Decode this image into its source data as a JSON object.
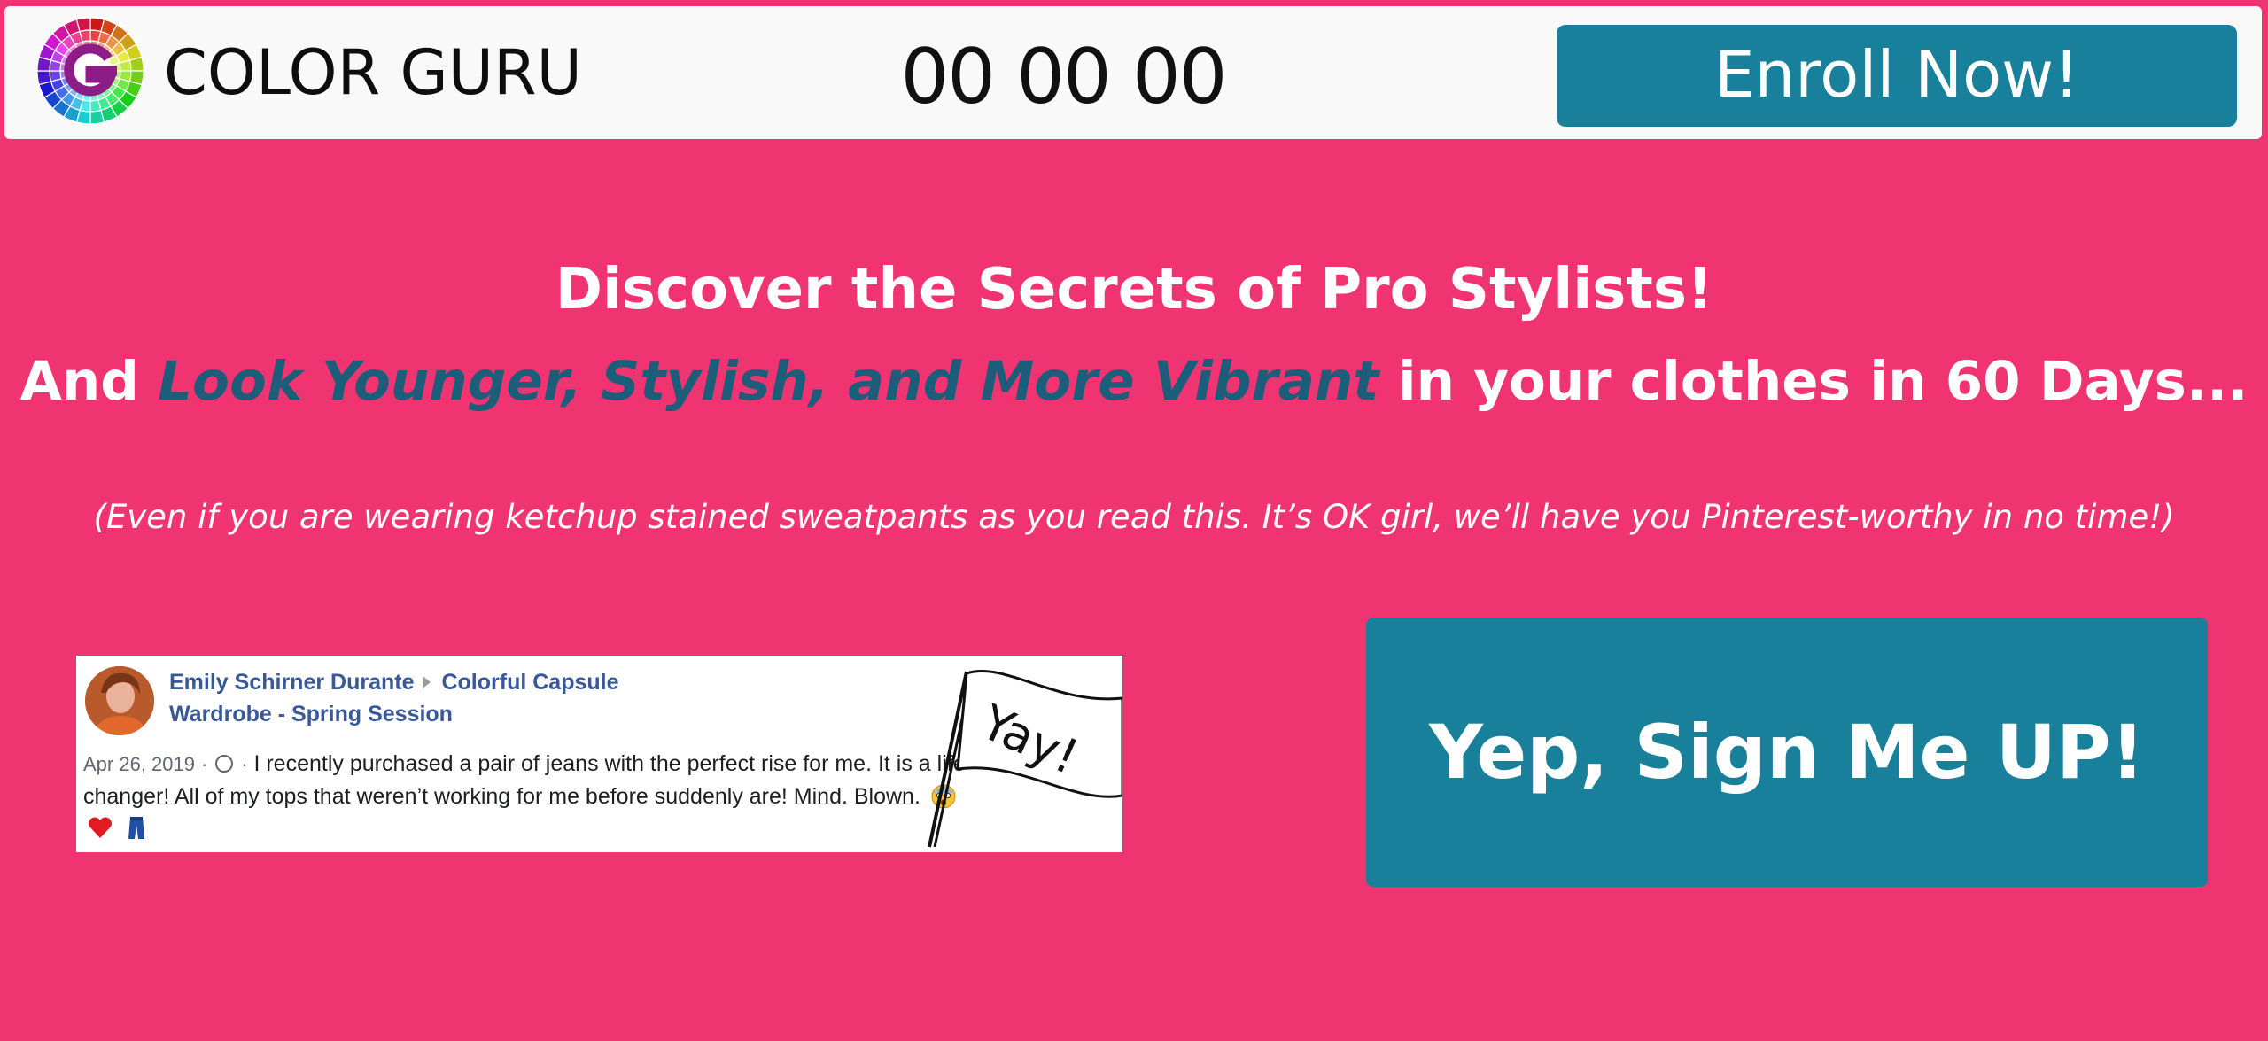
{
  "header": {
    "brand": "COLOR GURU",
    "countdown": "00 00 00",
    "enroll_label": "Enroll Now!"
  },
  "hero": {
    "headline": "Discover the Secrets of Pro Stylists!",
    "sub_prefix": "And ",
    "sub_accent": "Look Younger, Stylish, and More Vibrant",
    "sub_suffix": " in your clothes in 60 Days...",
    "note": "(Even if you are wearing ketchup stained sweatpants as you read this.  It’s OK girl, we’ll have you Pinterest-worthy in no time!)"
  },
  "testimonial": {
    "author": "Emily Schirner Durante",
    "group": "Colorful Capsule Wardrobe - Spring Session",
    "date": "Apr 26, 2019",
    "separator": "·",
    "text": "I recently purchased a pair of jeans with the perfect rise for me. It is a life changer! All of my tops that weren’t working for me before suddenly are! Mind. Blown.",
    "flag_text": "Yay!"
  },
  "cta": {
    "label": "Yep, Sign Me UP!"
  },
  "colors": {
    "background": "#F03471",
    "teal": "#19809B",
    "accent_text": "#1C5E7A",
    "facebook_link": "#385898"
  },
  "icons": {
    "logo": "color-wheel-logo",
    "globe": "globe-icon",
    "emoji_1": "shocked-face-emoji",
    "emoji_2": "red-heart-emoji",
    "emoji_3": "jeans-emoji",
    "flag": "yay-flag-drawing"
  }
}
